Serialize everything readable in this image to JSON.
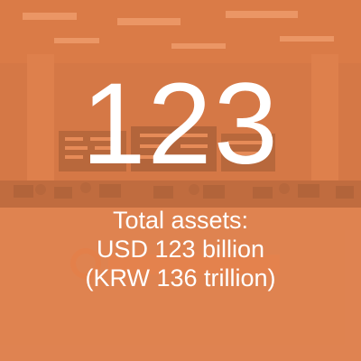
{
  "headline_number": "123",
  "caption": {
    "line1": "Total assets:",
    "line2": "USD 123 billion",
    "line3": "(KRW 136 trillion)"
  },
  "colors": {
    "overlay": "#e8824b",
    "text": "#ffffff"
  }
}
